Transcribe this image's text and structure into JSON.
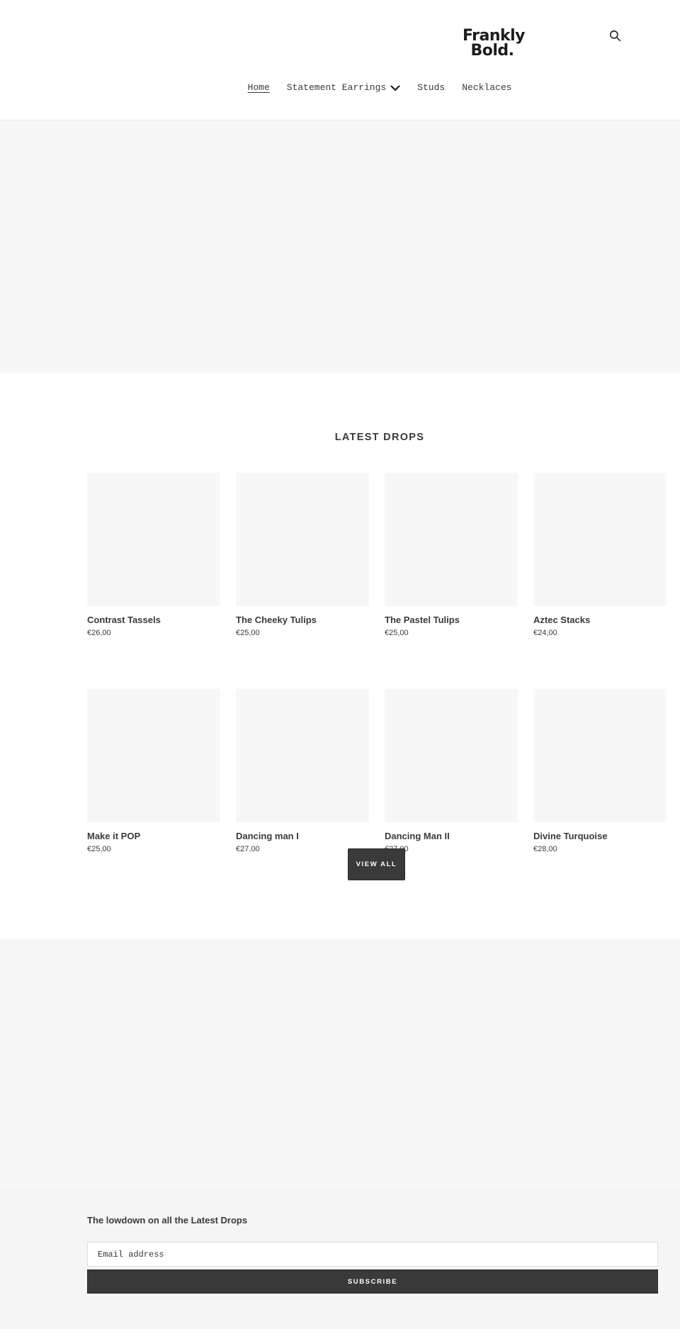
{
  "header": {
    "logo_line1": "Frankly",
    "logo_line2": "Bold.",
    "search_icon": "search-icon",
    "nav": [
      {
        "label": "Home",
        "active": true
      },
      {
        "label": "Statement Earrings",
        "has_dropdown": true,
        "icon": "chevron-down-icon"
      },
      {
        "label": "Studs"
      },
      {
        "label": "Necklaces"
      }
    ]
  },
  "latest": {
    "title": "LATEST DROPS",
    "products": [
      {
        "name": "Contrast Tassels",
        "price": "€26,00"
      },
      {
        "name": "The Cheeky Tulips",
        "price": "€25,00"
      },
      {
        "name": "The Pastel Tulips",
        "price": "€25,00"
      },
      {
        "name": "Aztec Stacks",
        "price": "€24,00"
      },
      {
        "name": "Make it POP",
        "price": "€25,00"
      },
      {
        "name": "Dancing man I",
        "price": "€27,00"
      },
      {
        "name": "Dancing Man II",
        "price": "€27,00"
      },
      {
        "name": "Divine Turquoise",
        "price": "€28,00"
      }
    ],
    "view_all_label": "VIEW ALL"
  },
  "newsletter": {
    "heading": "The lowdown on all the Latest Drops",
    "email_placeholder": "Email address",
    "subscribe_label": "SUBSCRIBE"
  },
  "colors": {
    "text": "#3a3a3a",
    "button_bg": "#3a3a3a",
    "placeholder_bg": "#f7f7f7",
    "newsletter_bg": "#f5f5f5"
  }
}
